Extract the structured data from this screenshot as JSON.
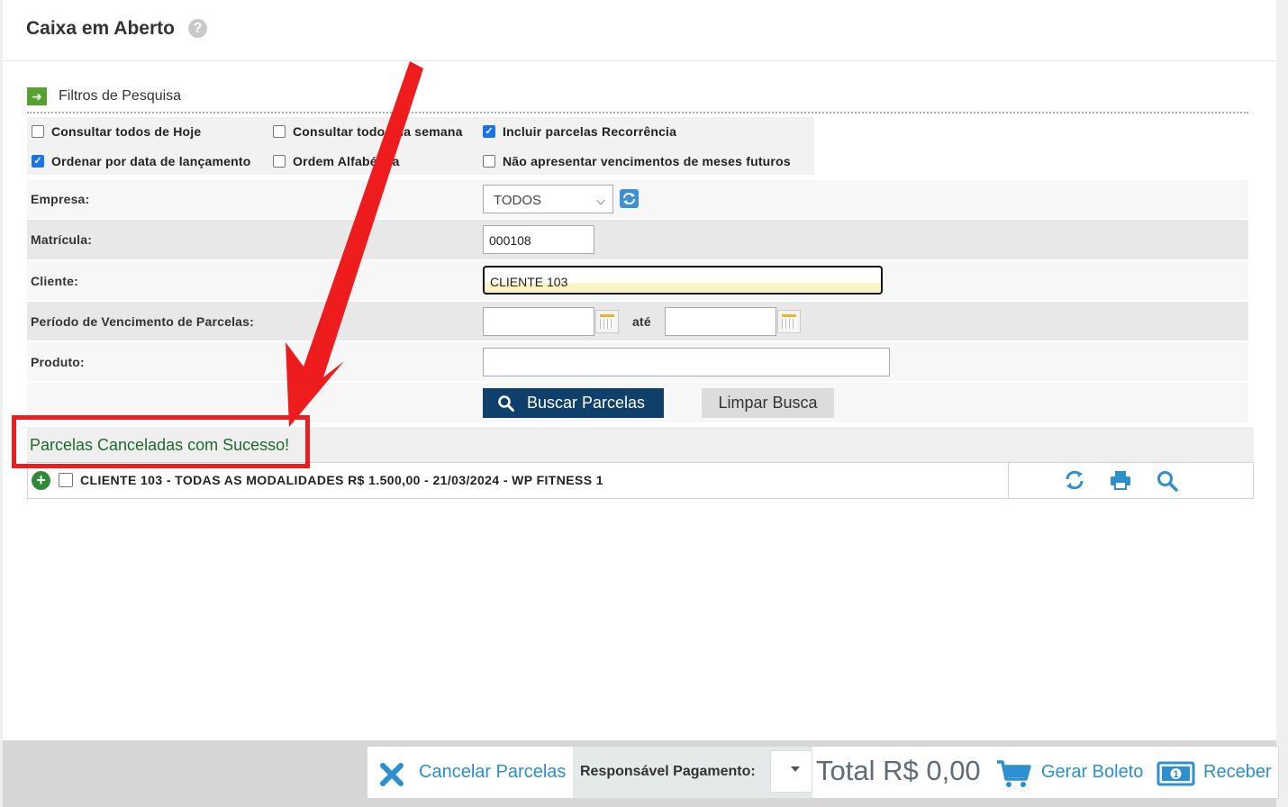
{
  "header": {
    "title": "Caixa em Aberto",
    "help_icon": "?"
  },
  "filters": {
    "title": "Filtros de Pesquisa",
    "options": [
      {
        "label": "Consultar todos de Hoje",
        "checked": false
      },
      {
        "label": "Consultar todos da semana",
        "checked": false
      },
      {
        "label": "Incluir parcelas Recorrência",
        "checked": true
      },
      {
        "label": "Ordenar por data de lançamento",
        "checked": true
      },
      {
        "label": "Ordem Alfabética",
        "checked": false
      },
      {
        "label": "Não apresentar vencimentos de meses futuros",
        "checked": false
      }
    ]
  },
  "form": {
    "empresa_label": "Empresa:",
    "empresa_value": "TODOS",
    "matricula_label": "Matrícula:",
    "matricula_value": "000108",
    "cliente_label": "Cliente:",
    "cliente_value": "CLIENTE 103",
    "periodo_label": "Período de Vencimento de Parcelas:",
    "periodo_ate": "até",
    "periodo_start": "",
    "periodo_end": "",
    "produto_label": "Produto:",
    "produto_value": ""
  },
  "actions": {
    "buscar": "Buscar Parcelas",
    "limpar": "Limpar Busca"
  },
  "message": "Parcelas Canceladas com Sucesso!",
  "results": [
    {
      "text": "CLIENTE 103 - TODAS AS MODALIDADES R$ 1.500,00 - 21/03/2024 - WP FITNESS 1",
      "checked": false
    }
  ],
  "footer": {
    "cancelar": "Cancelar Parcelas",
    "responsavel_label": "Responsável Pagamento:",
    "responsavel_value": "",
    "total": "Total R$ 0,00",
    "gerar_boleto": "Gerar Boleto",
    "receber": "Receber"
  },
  "colors": {
    "primary": "#0f3f6b",
    "link": "#2b8fd0",
    "success": "#1e6a2b",
    "annotation": "#ee1c1c"
  }
}
